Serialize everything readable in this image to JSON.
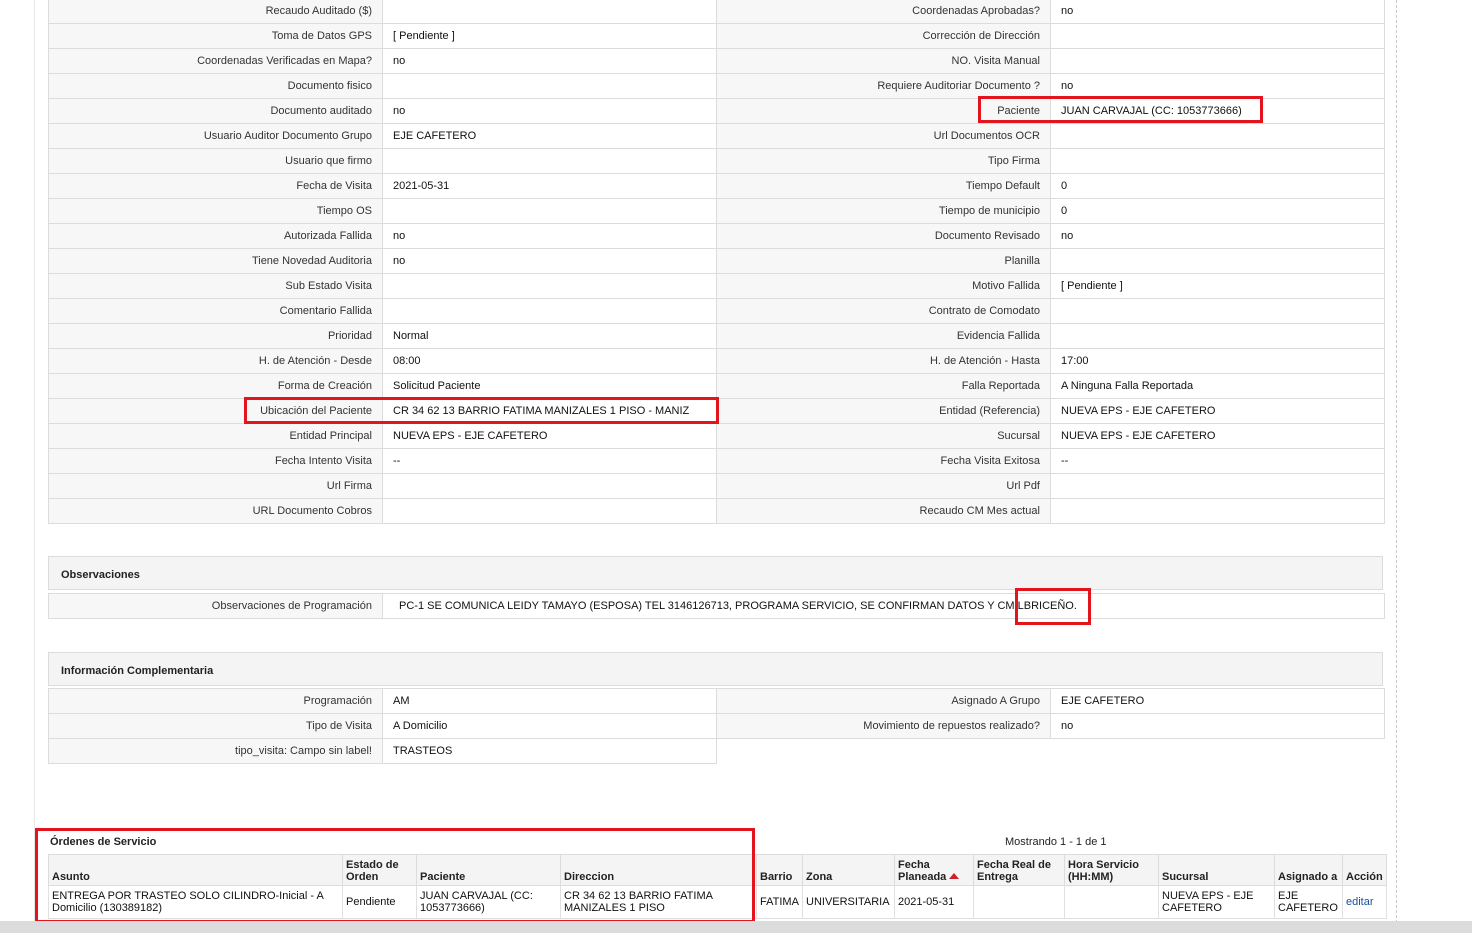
{
  "details": [
    {
      "l1": "Recaudo Auditado ($)",
      "v1": "",
      "l2": "Coordenadas Aprobadas?",
      "v2": "no"
    },
    {
      "l1": "Toma de Datos GPS",
      "v1": "[ Pendiente ]",
      "l2": "Corrección de Dirección",
      "v2": ""
    },
    {
      "l1": "Coordenadas Verificadas en Mapa?",
      "v1": "no",
      "l2": "NO. Visita Manual",
      "v2": ""
    },
    {
      "l1": "Documento fisico",
      "v1": "",
      "l2": "Requiere Auditoriar Documento ?",
      "v2": "no"
    },
    {
      "l1": "Documento auditado",
      "v1": "no",
      "l2": "Paciente",
      "v2": "JUAN CARVAJAL (CC: 1053773666)"
    },
    {
      "l1": "Usuario Auditor Documento Grupo",
      "v1": "EJE CAFETERO",
      "l2": "Url Documentos OCR",
      "v2": ""
    },
    {
      "l1": "Usuario que firmo",
      "v1": "",
      "l2": "Tipo Firma",
      "v2": ""
    },
    {
      "l1": "Fecha de Visita",
      "v1": "2021-05-31",
      "l2": "Tiempo Default",
      "v2": "0"
    },
    {
      "l1": "Tiempo OS",
      "v1": "",
      "l2": "Tiempo de municipio",
      "v2": "0"
    },
    {
      "l1": "Autorizada Fallida",
      "v1": "no",
      "l2": "Documento Revisado",
      "v2": "no"
    },
    {
      "l1": "Tiene Novedad Auditoria",
      "v1": "no",
      "l2": "Planilla",
      "v2": ""
    },
    {
      "l1": "Sub Estado Visita",
      "v1": "",
      "l2": "Motivo Fallida",
      "v2": "[ Pendiente ]"
    },
    {
      "l1": "Comentario Fallida",
      "v1": "",
      "l2": "Contrato de Comodato",
      "v2": ""
    },
    {
      "l1": "Prioridad",
      "v1": "Normal",
      "l2": "Evidencia Fallida",
      "v2": ""
    },
    {
      "l1": "H. de Atención - Desde",
      "v1": "08:00",
      "l2": "H. de Atención - Hasta",
      "v2": "17:00"
    },
    {
      "l1": "Forma de Creación",
      "v1": "Solicitud Paciente",
      "l2": "Falla Reportada",
      "v2": "A Ninguna Falla Reportada"
    },
    {
      "l1": "Ubicación del Paciente",
      "v1": "CR 34 62 13 BARRIO FATIMA MANIZALES 1 PISO - MANIZ",
      "l2": "Entidad (Referencia)",
      "v2": "NUEVA EPS - EJE CAFETERO"
    },
    {
      "l1": "Entidad Principal",
      "v1": "NUEVA EPS - EJE CAFETERO",
      "l2": "Sucursal",
      "v2": "NUEVA EPS - EJE CAFETERO"
    },
    {
      "l1": "Fecha Intento Visita",
      "v1": "--",
      "l2": "Fecha Visita Exitosa",
      "v2": "--"
    },
    {
      "l1": "Url Firma",
      "v1": "",
      "l2": "Url Pdf",
      "v2": ""
    },
    {
      "l1": "URL Documento Cobros",
      "v1": "",
      "l2": "Recaudo CM Mes actual",
      "v2": ""
    }
  ],
  "observaciones": {
    "title": "Observaciones",
    "label": "Observaciones de Programación",
    "value": "PC-1 SE COMUNICA LEIDY TAMAYO (ESPOSA) TEL 3146126713, PROGRAMA SERVICIO, SE CONFIRMAN DATOS Y CM LBRICEÑO."
  },
  "info": {
    "title": "Información Complementaria",
    "rows": [
      {
        "l1": "Programación",
        "v1": "AM",
        "l2": "Asignado A Grupo",
        "v2": "EJE CAFETERO"
      },
      {
        "l1": "Tipo de Visita",
        "v1": "A Domicilio",
        "l2": "Movimiento de repuestos realizado?",
        "v2": "no"
      },
      {
        "l1": "tipo_visita: Campo sin label!",
        "v1": "TRASTEOS"
      }
    ]
  },
  "orders": {
    "title": "Órdenes de Servicio",
    "paging": "Mostrando 1 - 1 de 1",
    "columns": [
      "Asunto",
      "Estado de Orden",
      "Paciente",
      "Direccion",
      "Barrio",
      "Zona",
      "Fecha Planeada",
      "Fecha Real de Entrega",
      "Hora Servicio (HH:MM)",
      "Sucursal",
      "Asignado a",
      "Acción"
    ],
    "rows": [
      {
        "asunto": "ENTREGA POR TRASTEO SOLO CILINDRO-Inicial - A Domicilio (130389182)",
        "estado": "Pendiente",
        "paciente": "JUAN CARVAJAL (CC: 1053773666)",
        "direccion": "CR 34 62 13 BARRIO FATIMA MANIZALES 1 PISO",
        "barrio": "FATIMA",
        "zona": "UNIVERSITARIA",
        "fecha_planeada": "2021-05-31",
        "fecha_real": "",
        "hora": "",
        "sucursal": "NUEVA EPS - EJE CAFETERO",
        "asignado": "EJE CAFETERO",
        "accion": "editar"
      }
    ]
  },
  "colors": {
    "highlight": "#e3141e",
    "link": "#1a4f9c"
  }
}
